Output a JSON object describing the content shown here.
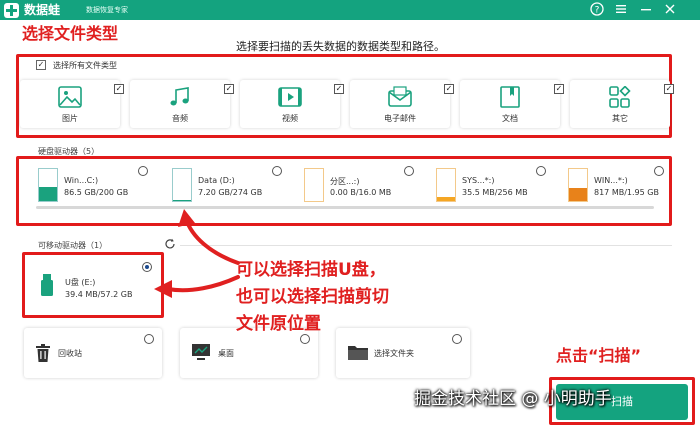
{
  "app": {
    "name": "数据蛙",
    "subtitle": "数据恢复专家"
  },
  "colors": {
    "brand": "#14a37f",
    "annotation": "#e02020",
    "selected_radio": "#1b4a8e"
  },
  "headings": {
    "file_types": "选择文件类型",
    "instruction": "选择要扫描的丢失数据的数据类型和路径。"
  },
  "file_types": {
    "select_all": "选择所有文件类型",
    "items": [
      {
        "label": "图片",
        "icon": "image-icon",
        "checked": true
      },
      {
        "label": "音频",
        "icon": "music-icon",
        "checked": true
      },
      {
        "label": "视频",
        "icon": "video-icon",
        "checked": true
      },
      {
        "label": "电子邮件",
        "icon": "email-icon",
        "checked": true
      },
      {
        "label": "文档",
        "icon": "document-icon",
        "checked": true
      },
      {
        "label": "其它",
        "icon": "other-icon",
        "checked": true
      }
    ]
  },
  "hard_drives": {
    "label": "硬盘驱动器（5）",
    "items": [
      {
        "name": "Win...C:)",
        "size": "86.5 GB/200 GB",
        "usage": 0.43,
        "color": "#1aa27e"
      },
      {
        "name": "Data (D:)",
        "size": "7.20 GB/274 GB",
        "usage": 0.03,
        "color": "#1aa27e"
      },
      {
        "name": "分区...:)",
        "size": "0.00  B/16.0 MB",
        "usage": 0.0,
        "color": "#f0a020"
      },
      {
        "name": "SYS...*:)",
        "size": "35.5 MB/256 MB",
        "usage": 0.14,
        "color": "#f5a623"
      },
      {
        "name": "WIN...*:)",
        "size": "817 MB/1.95 GB",
        "usage": 0.41,
        "color": "#e8821a"
      }
    ]
  },
  "removable": {
    "label": "可移动驱动器（1）",
    "drive": {
      "name": "U盘 (E:)",
      "size": "39.4 MB/57.2 GB",
      "selected": true
    }
  },
  "locations": [
    {
      "label": "回收站",
      "icon": "recycle-bin-icon"
    },
    {
      "label": "桌面",
      "icon": "desktop-icon"
    },
    {
      "label": "选择文件夹",
      "icon": "folder-icon"
    }
  ],
  "annotations": {
    "usb_line1": "可以选择扫描U盘，",
    "usb_line2": "也可以选择扫描剪切",
    "usb_line3": "文件原位置",
    "click_scan": "点击“扫描”"
  },
  "scan_button": "扫描",
  "watermark": "掘金技术社区 @ 小明助手"
}
